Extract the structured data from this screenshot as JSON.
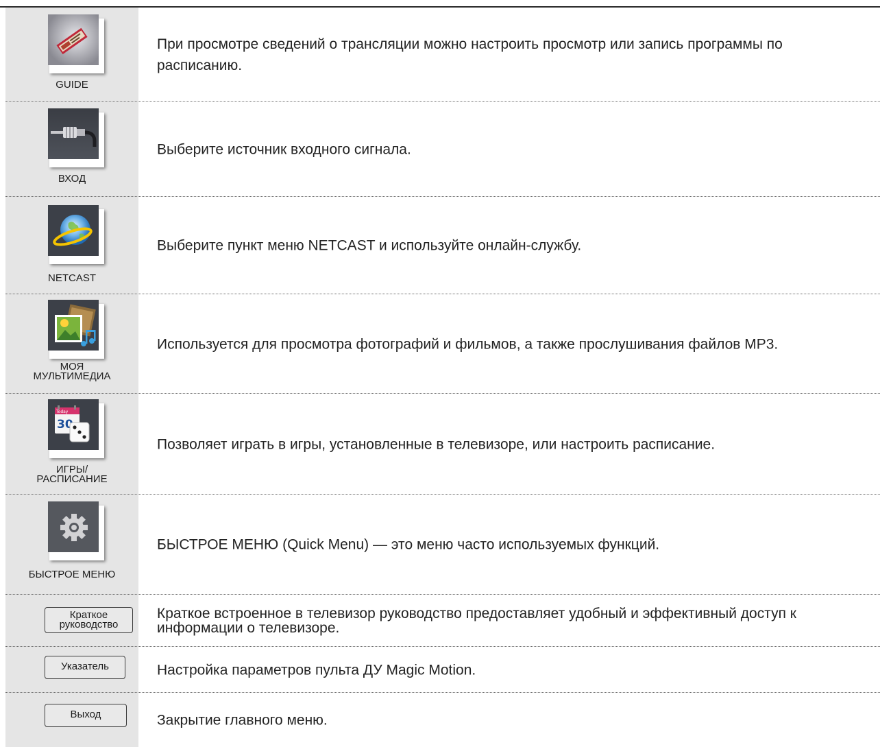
{
  "items": [
    {
      "icon": "guide-icon",
      "caption": "GUIDE",
      "description": "При просмотре сведений о трансляции можно настроить просмотр или запись программы по расписанию."
    },
    {
      "icon": "input-cable-icon",
      "caption": "ВХОД",
      "description": "Выберите источник входного сигнала."
    },
    {
      "icon": "globe-icon",
      "caption": "NETCAST",
      "description": "Выберите пункт меню NETCAST и используйте онлайн-службу."
    },
    {
      "icon": "media-icon",
      "caption_lines": [
        "МОЯ",
        "МУЛЬТИМЕДИА"
      ],
      "description": "Используется для просмотра фотографий и фильмов, а также прослушивания файлов MP3."
    },
    {
      "icon": "calendar-dice-icon",
      "calendar_label": "Today",
      "calendar_day": "30",
      "caption_lines": [
        "ИГРЫ/",
        "РАСПИСАНИЕ"
      ],
      "description": "Позволяет играть в игры, установленные в телевизоре, или настроить расписание."
    },
    {
      "icon": "gear-icon",
      "caption": "БЫСТРОЕ МЕНЮ",
      "description": "БЫСТРОЕ МЕНЮ (Quick Menu) — это меню часто используемых функций."
    },
    {
      "button_lines": [
        "Краткое",
        "руководство"
      ],
      "description": "Краткое встроенное в телевизор руководство предоставляет удобный и эффективный доступ к информации о телевизоре."
    },
    {
      "button": "Указатель",
      "description": "Настройка параметров пульта ДУ Magic Motion."
    },
    {
      "button": "Выход",
      "description": "Закрытие главного меню."
    }
  ]
}
